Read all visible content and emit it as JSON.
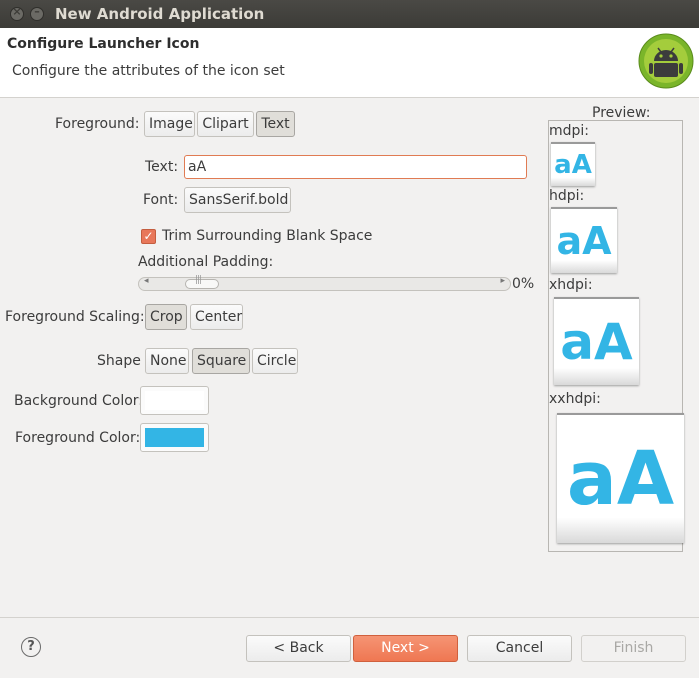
{
  "window": {
    "title": "New Android Application",
    "close_glyph": "×",
    "minimize_glyph": "–"
  },
  "header": {
    "title": "Configure Launcher Icon",
    "subtitle": "Configure the attributes of the icon set"
  },
  "form": {
    "foreground_label": "Foreground:",
    "foreground_options": [
      "Image",
      "Clipart",
      "Text"
    ],
    "foreground_selected": "Text",
    "text_label": "Text:",
    "text_value": "aA",
    "font_label": "Font:",
    "font_value": "SansSerif.bold",
    "trim_label": "Trim Surrounding Blank Space",
    "trim_checked": true,
    "padding_label": "Additional Padding:",
    "padding_value": "0%",
    "scaling_label": "Foreground Scaling:",
    "scaling_options": [
      "Crop",
      "Center"
    ],
    "scaling_selected": "Crop",
    "shape_label": "Shape",
    "shape_options": [
      "None",
      "Square",
      "Circle"
    ],
    "shape_selected": "Square",
    "bg_color_label": "Background Color:",
    "bg_color": "#ffffff",
    "fg_color_label": "Foreground Color:",
    "fg_color": "#33b5e5"
  },
  "preview": {
    "label": "Preview:",
    "densities": [
      "mdpi:",
      "hdpi:",
      "xhdpi:",
      "xxhdpi:"
    ],
    "icon_text": "aA"
  },
  "footer": {
    "help_glyph": "?",
    "back": "< Back",
    "next": "Next >",
    "cancel": "Cancel",
    "finish": "Finish"
  },
  "icons": [
    "close-icon",
    "minimize-icon",
    "android-logo-icon",
    "help-icon",
    "checkmark-icon"
  ],
  "colors": {
    "accent": "#ef7752",
    "icon_blue": "#33b5e5",
    "titlebar": "#3c3b37"
  }
}
